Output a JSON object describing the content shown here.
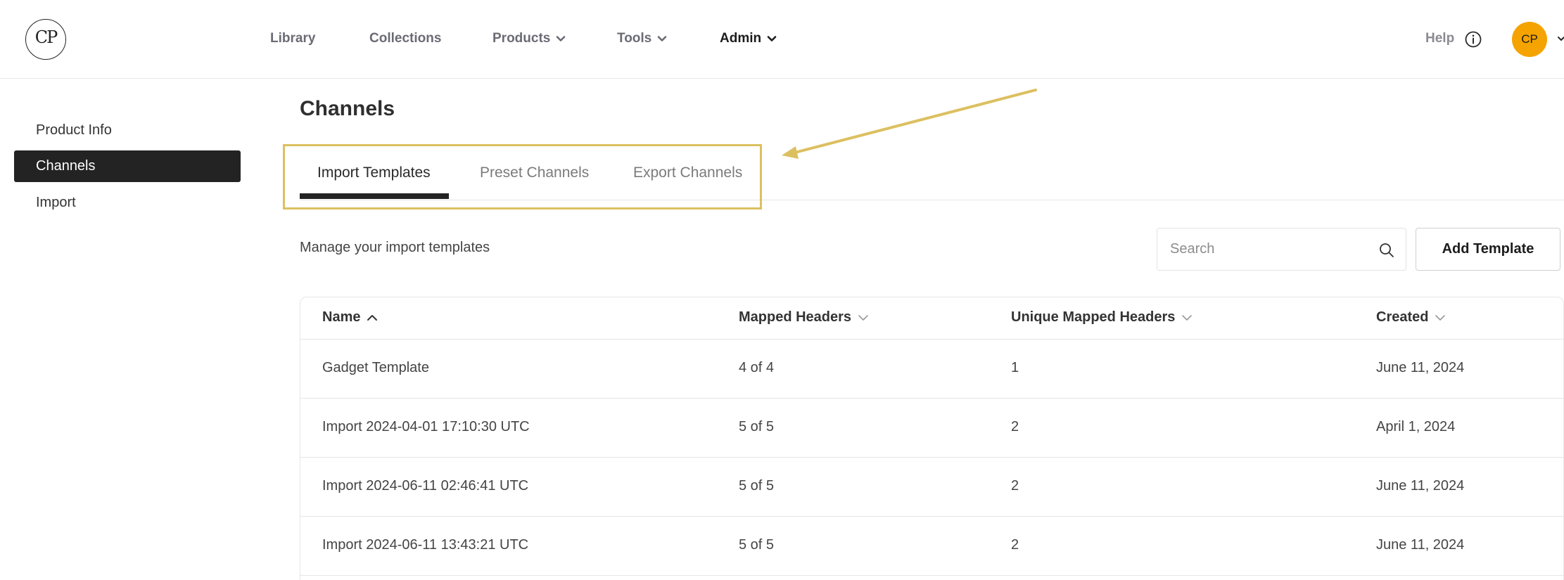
{
  "header": {
    "logo_text": "CP",
    "nav": [
      {
        "label": "Library"
      },
      {
        "label": "Collections"
      },
      {
        "label": "Products"
      },
      {
        "label": "Tools"
      },
      {
        "label": "Admin"
      }
    ],
    "help_label": "Help",
    "avatar_initials": "CP",
    "avatar_color": "#f5a300"
  },
  "sidebar": {
    "items": [
      {
        "label": "Product Info"
      },
      {
        "label": "Channels"
      },
      {
        "label": "Import"
      }
    ]
  },
  "main": {
    "title": "Channels",
    "tabs": [
      {
        "label": "Import Templates"
      },
      {
        "label": "Preset Channels"
      },
      {
        "label": "Export Channels"
      }
    ],
    "subtitle": "Manage your import templates",
    "search_placeholder": "Search",
    "add_button_label": "Add Template",
    "annotation_color": "#dcc060"
  },
  "table": {
    "columns": [
      "Name",
      "Mapped Headers",
      "Unique Mapped Headers",
      "Created"
    ],
    "rows": [
      [
        "Gadget Template",
        "4 of 4",
        "1",
        "June 11, 2024"
      ],
      [
        "Import 2024-04-01 17:10:30 UTC",
        "5 of 5",
        "2",
        "April 1, 2024"
      ],
      [
        "Import 2024-06-11 02:46:41 UTC",
        "5 of 5",
        "2",
        "June 11, 2024"
      ],
      [
        "Import 2024-06-11 13:43:21 UTC",
        "5 of 5",
        "2",
        "June 11, 2024"
      ]
    ]
  }
}
